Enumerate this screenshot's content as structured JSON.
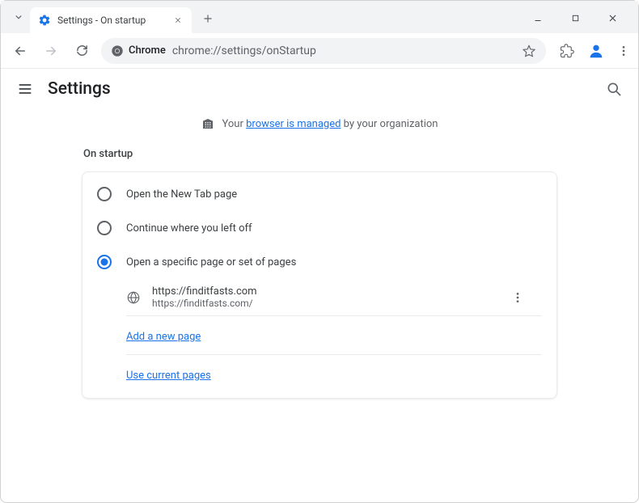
{
  "tab": {
    "title": "Settings - On startup"
  },
  "omnibox": {
    "brand": "Chrome",
    "url": "chrome://settings/onStartup"
  },
  "page": {
    "title": "Settings"
  },
  "banner": {
    "prefix": "Your ",
    "link": "browser is managed",
    "suffix": " by your organization"
  },
  "section": {
    "title": "On startup"
  },
  "options": [
    {
      "label": "Open the New Tab page",
      "selected": false
    },
    {
      "label": "Continue where you left off",
      "selected": false
    },
    {
      "label": "Open a specific page or set of pages",
      "selected": true
    }
  ],
  "startupPage": {
    "name": "https://finditfasts.com",
    "url": "https://finditfasts.com/"
  },
  "actions": {
    "addPage": "Add a new page",
    "useCurrent": "Use current pages"
  }
}
